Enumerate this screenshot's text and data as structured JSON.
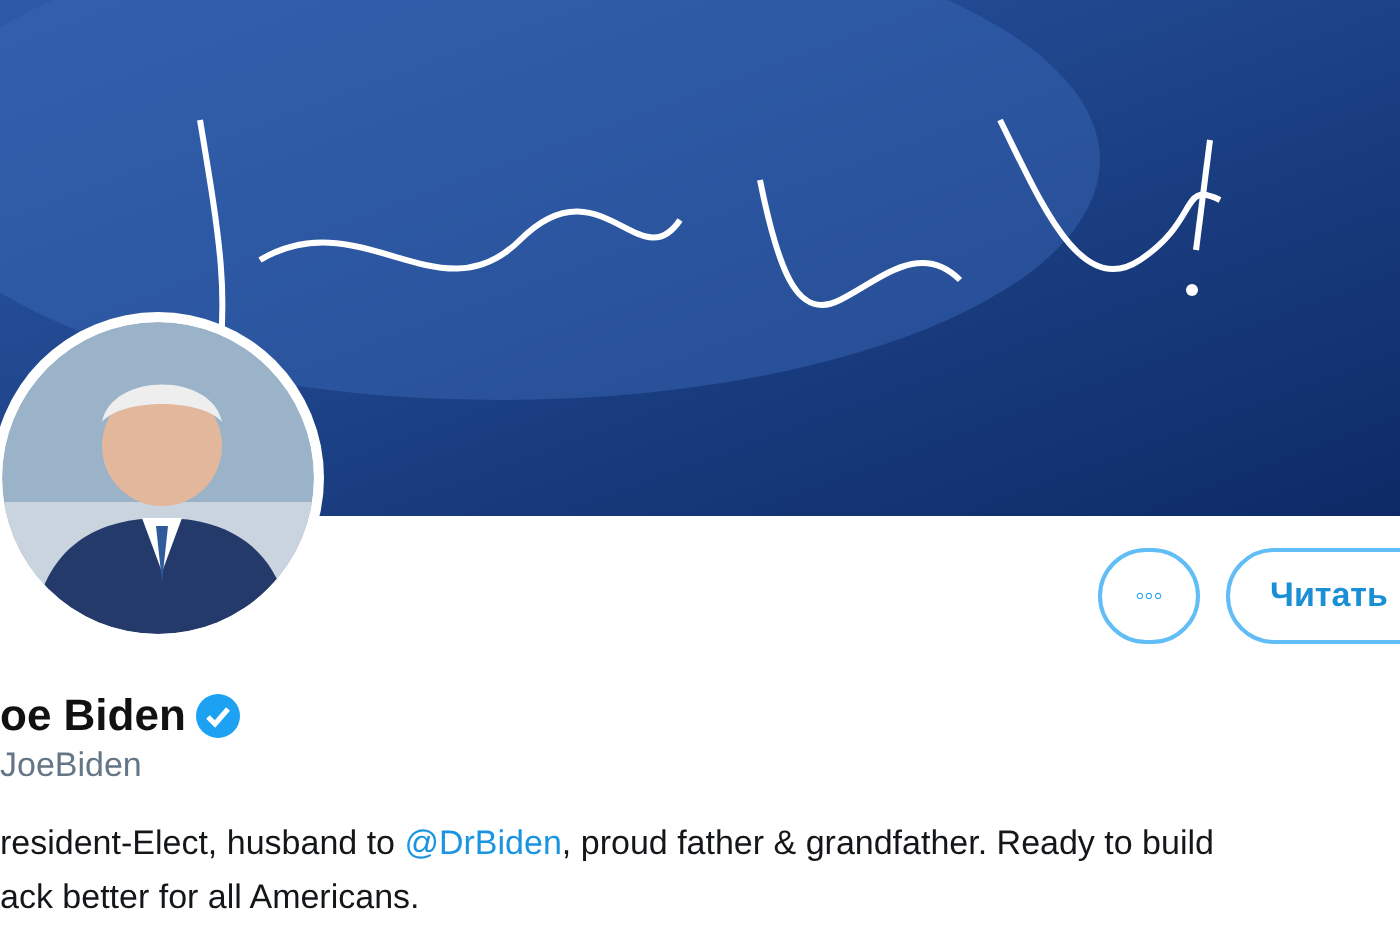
{
  "banner": {
    "kind": "picture"
  },
  "avatar": {
    "kind": "picture"
  },
  "actions": [
    {
      "kind": "more",
      "label": "◦◦◦"
    },
    {
      "kind": "follow",
      "label": "Читать"
    }
  ],
  "profile": {
    "name": "oe Biden",
    "verified": true,
    "handle": "JoeBiden"
  },
  "bio": [
    [
      {
        "kind": "text",
        "text": "resident-Elect, husband to "
      },
      {
        "kind": "link",
        "text": "@DrBiden"
      },
      {
        "kind": "text",
        "text": ", proud father & grandfather. Ready to build"
      }
    ],
    [
      {
        "kind": "text",
        "text": "ack better for all Americans."
      }
    ]
  ]
}
